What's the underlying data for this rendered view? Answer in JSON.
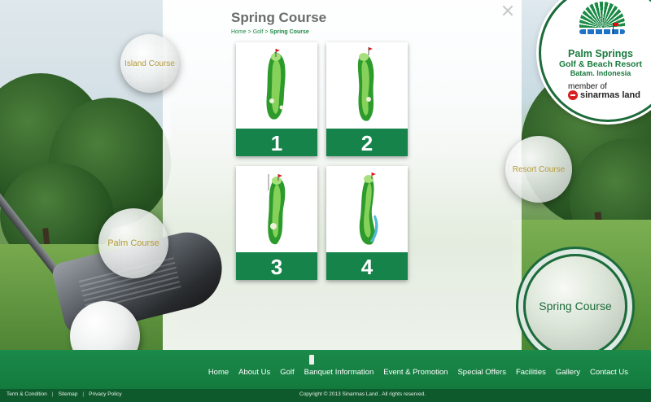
{
  "header": {
    "page_title": "Spring Course",
    "breadcrumb": {
      "home": "Home",
      "separator": ">",
      "golf": "Golf",
      "current": "Spring Course"
    }
  },
  "course_balls": {
    "island": "Island Course",
    "palm": "Palm Course",
    "resort": "Resort Course",
    "spring": "Spring Course",
    "active": "Spring Course"
  },
  "logo": {
    "name": "Palm Springs",
    "subtitle": "Golf & Beach Resort",
    "location": "Batam. Indonesia",
    "member": "member of",
    "partner": "sinarmas land"
  },
  "holes": [
    {
      "number": "1"
    },
    {
      "number": "2"
    },
    {
      "number": "3"
    },
    {
      "number": "4"
    }
  ],
  "nav": {
    "items": [
      "Home",
      "About Us",
      "Golf",
      "Banquet Information",
      "Event & Promotion",
      "Special Offers",
      "Facilities",
      "Gallery",
      "Contact Us"
    ]
  },
  "footer": {
    "links": [
      "Term & Condition",
      "Sitemap",
      "Privacy Policy"
    ],
    "separator": "|",
    "copyright": "Copyright © 2013  Sinarmas Land . All rights reserved."
  },
  "colors": {
    "brand_green": "#15834a",
    "footer_dark": "#0f5a2d",
    "accent_gold": "#b59a3a"
  },
  "icons": [
    "close-icon",
    "flag-icon"
  ]
}
